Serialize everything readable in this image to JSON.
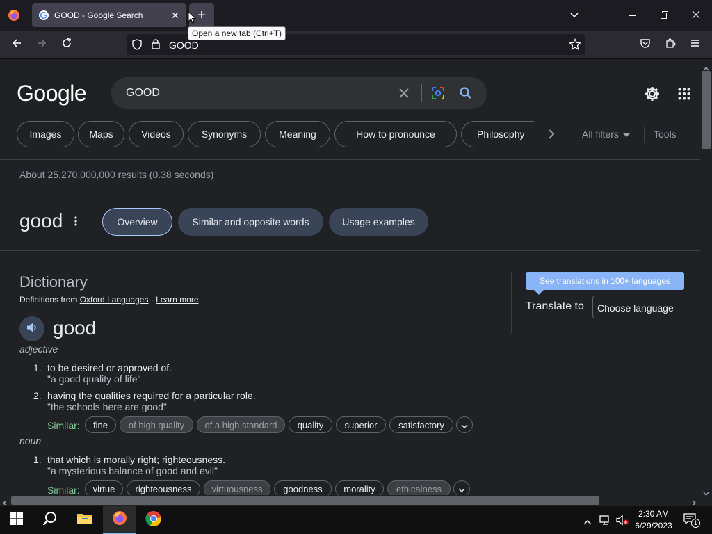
{
  "browser": {
    "tab_title": "GOOD - Google Search",
    "url": "GOOD",
    "tooltip": "Open a new tab (Ctrl+T)"
  },
  "search": {
    "logo": "Google",
    "query": "GOOD",
    "chips": [
      "Images",
      "Maps",
      "Videos",
      "Synonyms",
      "Meaning",
      "How to pronounce",
      "Philosophy"
    ],
    "all_filters": "All filters",
    "tools": "Tools",
    "result_stats": "About 25,270,000,000 results (0.38 seconds)"
  },
  "word_header": {
    "word": "good",
    "tabs": [
      "Overview",
      "Similar and opposite words",
      "Usage examples"
    ]
  },
  "dictionary": {
    "title": "Dictionary",
    "source_prefix": "Definitions from",
    "source_link": "Oxford Languages",
    "separator": "·",
    "learn_more": "Learn more",
    "headword": "good",
    "adjective": {
      "pos": "adjective",
      "defs": [
        {
          "num": "1.",
          "text": "to be desired or approved of.",
          "example": "\"a good quality of life\""
        },
        {
          "num": "2.",
          "text": "having the qualities required for a particular role.",
          "example": "\"the schools here are good\""
        }
      ],
      "similar_label": "Similar:",
      "similar": [
        "fine",
        "of high quality",
        "of a high standard",
        "quality",
        "superior",
        "satisfactory"
      ]
    },
    "noun": {
      "pos": "noun",
      "defs": [
        {
          "num": "1.",
          "text_before": "that which is ",
          "text_link": "morally",
          "text_after": " right; righteousness.",
          "example": "\"a mysterious balance of good and evil\""
        }
      ],
      "similar_label": "Similar:",
      "similar": [
        "virtue",
        "righteousness",
        "virtuousness",
        "goodness",
        "morality",
        "ethicalness"
      ]
    }
  },
  "translate": {
    "banner": "See translations in 100+ languages",
    "label": "Translate to",
    "placeholder": "Choose language"
  },
  "taskbar": {
    "time": "2:30 AM",
    "date": "6/29/2023",
    "notification_count": "1"
  }
}
